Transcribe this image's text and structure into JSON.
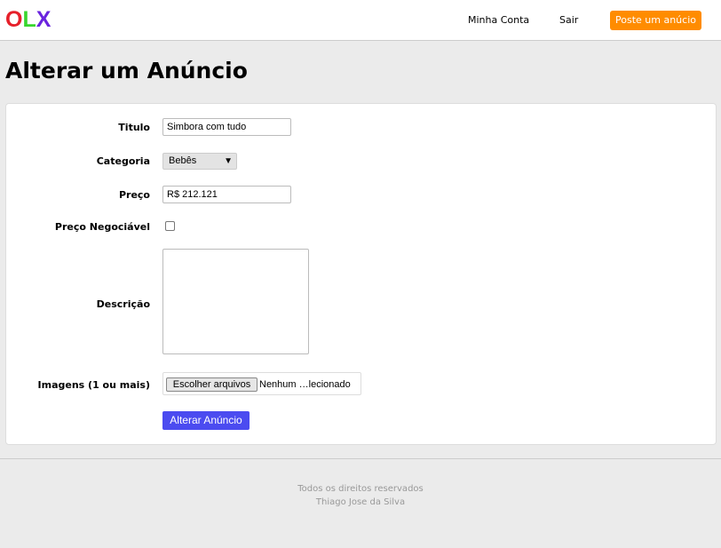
{
  "header": {
    "logo": {
      "o": "O",
      "l": "L",
      "x": "X"
    },
    "links": {
      "account": "Minha Conta",
      "logout": "Sair"
    },
    "post_button": "Poste um anúcio"
  },
  "page": {
    "title": "Alterar um Anúncio"
  },
  "form": {
    "title": {
      "label": "Titulo",
      "value": "Simbora com tudo"
    },
    "category": {
      "label": "Categoria",
      "selected": "Bebês"
    },
    "price": {
      "label": "Preço",
      "value": "R$ 212.121"
    },
    "negotiable": {
      "label": "Preço Negociável",
      "checked": false
    },
    "description": {
      "label": "Descrição",
      "value": ""
    },
    "images": {
      "label": "Imagens (1 ou mais)",
      "button": "Escolher arquivos",
      "status": "Nenhum …lecionado"
    },
    "submit": "Alterar Anúncio"
  },
  "footer": {
    "line1": "Todos os direitos reservados",
    "line2": "Thiago Jose da Silva"
  },
  "colors": {
    "logo_o": "#e6202a",
    "logo_l": "#38d62e",
    "logo_x": "#6a24de",
    "post_button": "#ff8c00",
    "submit_button": "#4b4bf0"
  }
}
